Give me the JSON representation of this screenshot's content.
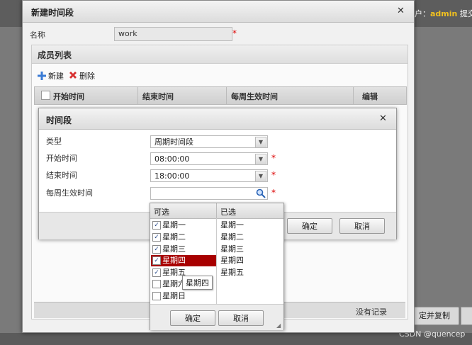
{
  "background": {
    "user_prefix": "户：",
    "user_name": "admin",
    "user_suffix": " 提交",
    "right_button": "定并复制",
    "watermark": "CSDN @quencep"
  },
  "dialog": {
    "title": "新建时间段",
    "name_label": "名称",
    "name_value": "work",
    "required_mark": "*",
    "member_list_title": "成员列表",
    "toolbar": {
      "new_label": "新建",
      "delete_label": "删除"
    },
    "grid_columns": [
      "开始时间",
      "结束时间",
      "每周生效时间",
      "编辑"
    ],
    "no_record": "没有记录"
  },
  "inner_dialog": {
    "title": "时间段",
    "fields": {
      "type": {
        "label": "类型",
        "value": "周期时间段"
      },
      "start": {
        "label": "开始时间",
        "value": "08:00:00"
      },
      "end": {
        "label": "结束时间",
        "value": "18:00:00"
      },
      "weekly": {
        "label": "每周生效时间",
        "value": ""
      }
    },
    "ok_label": "确定",
    "cancel_label": "取消"
  },
  "picker": {
    "available_header": "可选",
    "selected_header": "已选",
    "available": [
      {
        "label": "星期一",
        "checked": true
      },
      {
        "label": "星期二",
        "checked": true
      },
      {
        "label": "星期三",
        "checked": true
      },
      {
        "label": "星期四",
        "checked": true,
        "highlighted": true
      },
      {
        "label": "星期五",
        "checked": true
      },
      {
        "label": "星期六",
        "checked": false
      },
      {
        "label": "星期日",
        "checked": false
      }
    ],
    "selected": [
      "星期一",
      "星期二",
      "星期三",
      "星期四",
      "星期五"
    ],
    "ok_label": "确定",
    "cancel_label": "取消",
    "tooltip": "星期四"
  },
  "colors": {
    "highlight": "#a80000",
    "required": "#dd0000",
    "username": "#f0c020"
  }
}
